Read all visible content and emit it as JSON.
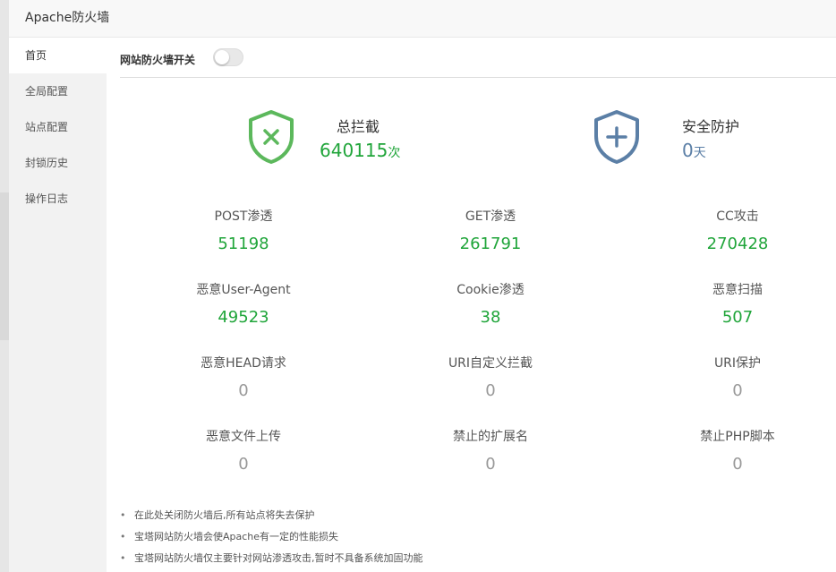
{
  "window": {
    "title": "Apache防火墙"
  },
  "sidebar": {
    "items": [
      {
        "label": "首页"
      },
      {
        "label": "全局配置"
      },
      {
        "label": "站点配置"
      },
      {
        "label": "封锁历史"
      },
      {
        "label": "操作日志"
      }
    ],
    "active_index": 0
  },
  "firewall_switch": {
    "label": "网站防火墙开关",
    "enabled": false
  },
  "summary": {
    "total_block": {
      "label": "总拦截",
      "value": "640115",
      "unit": "次",
      "icon": "shield-x-icon",
      "color": "#5cb85c"
    },
    "safe_days": {
      "label": "安全防护",
      "value": "0",
      "unit": "天",
      "icon": "shield-plus-icon",
      "color": "#5b7fa6"
    }
  },
  "stats": [
    {
      "label": "POST渗透",
      "value": "51198"
    },
    {
      "label": "GET渗透",
      "value": "261791"
    },
    {
      "label": "CC攻击",
      "value": "270428"
    },
    {
      "label": "恶意User-Agent",
      "value": "49523"
    },
    {
      "label": "Cookie渗透",
      "value": "38"
    },
    {
      "label": "恶意扫描",
      "value": "507"
    },
    {
      "label": "恶意HEAD请求",
      "value": "0"
    },
    {
      "label": "URI自定义拦截",
      "value": "0"
    },
    {
      "label": "URI保护",
      "value": "0"
    },
    {
      "label": "恶意文件上传",
      "value": "0"
    },
    {
      "label": "禁止的扩展名",
      "value": "0"
    },
    {
      "label": "禁止PHP脚本",
      "value": "0"
    }
  ],
  "notes": [
    "在此处关闭防火墙后,所有站点将失去保护",
    "宝塔网站防火墙会使Apache有一定的性能损失",
    "宝塔网站防火墙仅主要针对网站渗透攻击,暂时不具备系统加固功能"
  ],
  "colors": {
    "accent_green": "#20a53a",
    "accent_blue": "#5b7fa6",
    "zero_gray": "#999999"
  }
}
